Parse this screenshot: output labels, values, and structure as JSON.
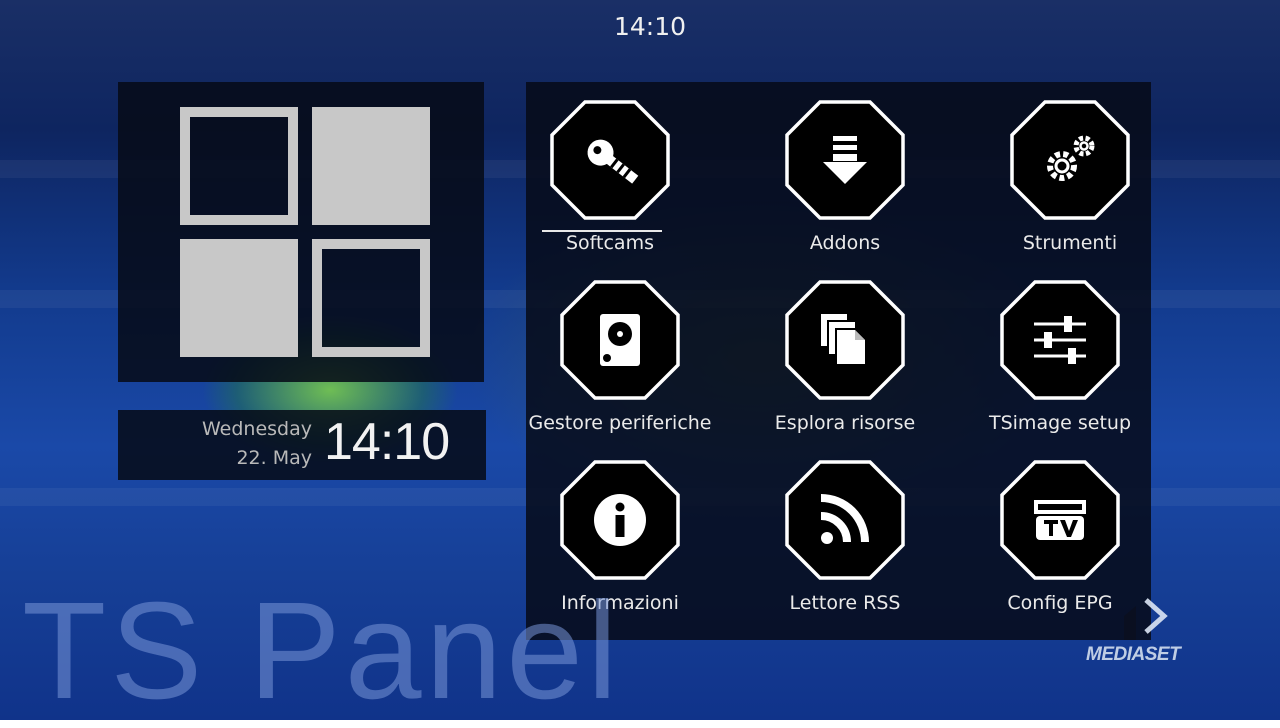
{
  "clock": {
    "top_time": "14:10"
  },
  "datetime": {
    "weekday": "Wednesday",
    "date": "22. May",
    "time": "14:10"
  },
  "brand": {
    "title": "TS Panel"
  },
  "overlay": {
    "channel": "MEDIASET"
  },
  "menu": {
    "selected_index": 0,
    "items": [
      {
        "label": "Softcams",
        "icon": "key-icon"
      },
      {
        "label": "Addons",
        "icon": "download-arrow-icon"
      },
      {
        "label": "Strumenti",
        "icon": "gears-icon"
      },
      {
        "label": "Gestore periferiche",
        "icon": "hard-disk-icon"
      },
      {
        "label": "Esplora risorse",
        "icon": "files-icon"
      },
      {
        "label": "TSimage setup",
        "icon": "sliders-icon"
      },
      {
        "label": "Informazioni",
        "icon": "info-icon"
      },
      {
        "label": "Lettore RSS",
        "icon": "rss-icon"
      },
      {
        "label": "Config EPG",
        "icon": "as-seen-on-tv-icon"
      }
    ]
  },
  "colors": {
    "tile": "#c8c8c8",
    "panel": "#060a16",
    "accent_text": "#eaeaea"
  }
}
